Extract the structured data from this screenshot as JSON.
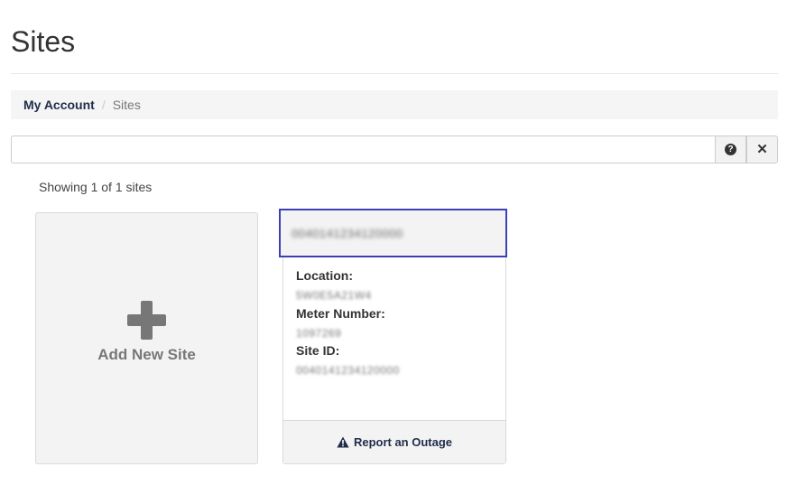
{
  "page": {
    "title": "Sites"
  },
  "breadcrumb": {
    "parent": "My Account",
    "separator": "/",
    "current": "Sites"
  },
  "search": {
    "value": "",
    "placeholder": ""
  },
  "results": {
    "summary": "Showing 1 of 1 sites"
  },
  "add_card": {
    "label": "Add New Site"
  },
  "site_card": {
    "header_id": "0040141234120000",
    "location_label": "Location:",
    "location_value": "5W0E5A21W4",
    "meter_label": "Meter Number:",
    "meter_value": "1097269",
    "site_id_label": "Site ID:",
    "site_id_value": "0040141234120000",
    "outage_label": "Report an Outage"
  },
  "icons": {
    "help": "question-circle-icon",
    "clear": "close-icon",
    "add": "plus-icon",
    "outage": "warning-triangle-icon"
  },
  "colors": {
    "selection_border": "#3f3fb5",
    "link": "#1f2d4a"
  }
}
